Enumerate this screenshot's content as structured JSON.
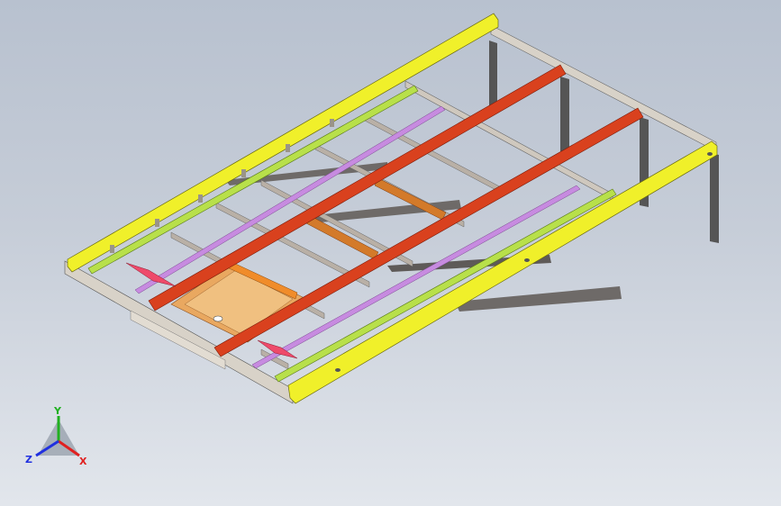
{
  "viewport": {
    "background_top": "#b8c1cf",
    "background_bottom": "#e2e6ec"
  },
  "model": {
    "description_icon": "trailer-frame-3d-model",
    "colors": {
      "outer_rail": "#f0f02a",
      "inner_rail": "#b8e04a",
      "main_beam": "#d9411e",
      "crossmember": "#b9b0a6",
      "tube": "#c78be0",
      "plate": "#f08c2a",
      "pad": "#ee4a6a",
      "leg": "#6e6a68",
      "end_frame": "#d8d2c8"
    }
  },
  "triad": {
    "x_label": "X",
    "y_label": "Y",
    "z_label": "Z",
    "x_color": "#e02020",
    "y_color": "#20b020",
    "z_color": "#2030e0"
  }
}
